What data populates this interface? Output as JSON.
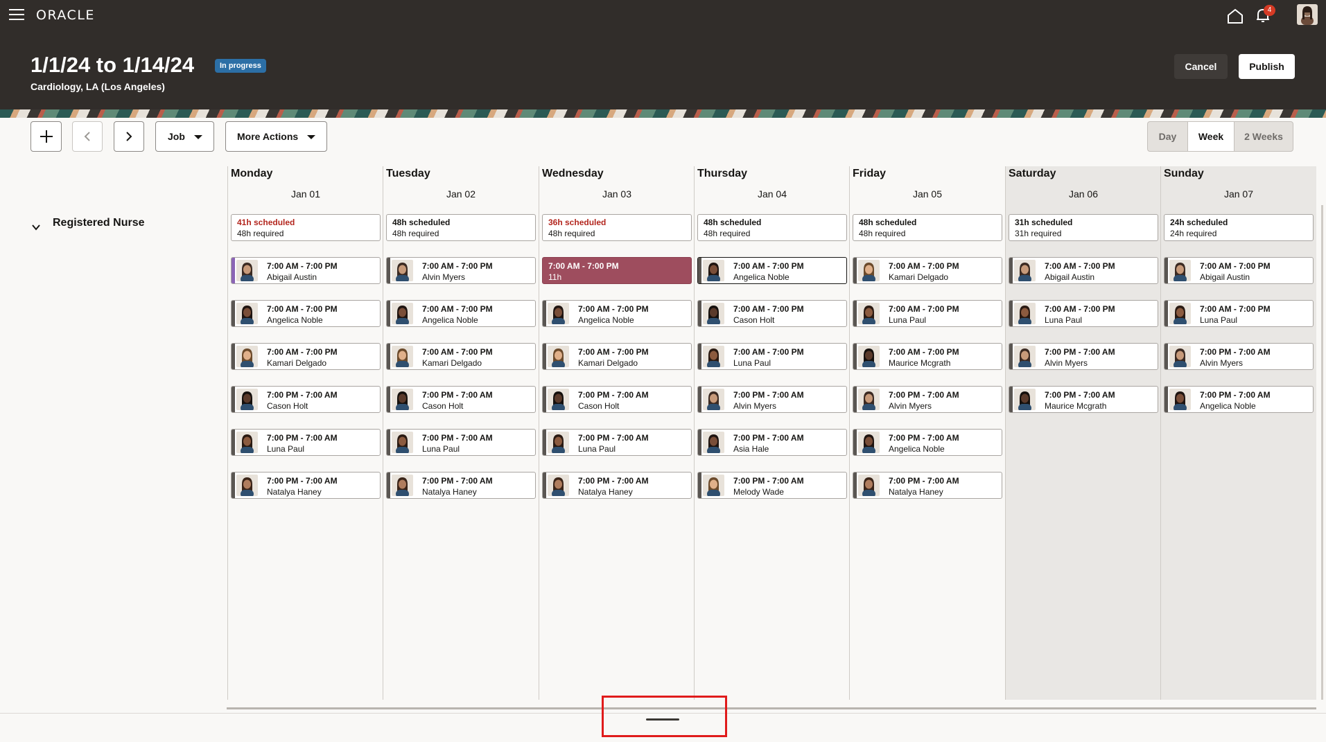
{
  "app": {
    "logo": "ORACLE",
    "notification_count": "4"
  },
  "header": {
    "title": "1/1/24 to 1/14/24",
    "status": "In progress",
    "subtitle": "Cardiology, LA (Los Angeles)",
    "cancel_label": "Cancel",
    "publish_label": "Publish"
  },
  "toolbar": {
    "job_label": "Job",
    "more_actions_label": "More Actions",
    "views": [
      {
        "label": "Day",
        "active": false
      },
      {
        "label": "Week",
        "active": true
      },
      {
        "label": "2 Weeks",
        "active": false
      }
    ]
  },
  "group": {
    "label": "Registered Nurse"
  },
  "days": [
    {
      "name": "Monday",
      "date": "Jan 01",
      "weekend": false,
      "scheduled": "41h scheduled",
      "required": "48h required",
      "under": true,
      "shifts": [
        {
          "time": "7:00 AM - 7:00 PM",
          "person": "Abigail Austin",
          "bar": "#8b64b5"
        },
        {
          "time": "7:00 AM - 7:00 PM",
          "person": "Angelica Noble"
        },
        {
          "time": "7:00 AM - 7:00 PM",
          "person": "Kamari Delgado"
        },
        {
          "time": "7:00 PM - 7:00 AM",
          "person": "Cason Holt"
        },
        {
          "time": "7:00 PM - 7:00 AM",
          "person": "Luna Paul"
        },
        {
          "time": "7:00 PM - 7:00 AM",
          "person": "Natalya Haney"
        }
      ]
    },
    {
      "name": "Tuesday",
      "date": "Jan 02",
      "weekend": false,
      "scheduled": "48h scheduled",
      "required": "48h required",
      "under": false,
      "shifts": [
        {
          "time": "7:00 AM - 7:00 PM",
          "person": "Alvin Myers"
        },
        {
          "time": "7:00 AM - 7:00 PM",
          "person": "Angelica Noble"
        },
        {
          "time": "7:00 AM - 7:00 PM",
          "person": "Kamari Delgado"
        },
        {
          "time": "7:00 PM - 7:00 AM",
          "person": "Cason Holt"
        },
        {
          "time": "7:00 PM - 7:00 AM",
          "person": "Luna Paul"
        },
        {
          "time": "7:00 PM - 7:00 AM",
          "person": "Natalya Haney"
        }
      ]
    },
    {
      "name": "Wednesday",
      "date": "Jan 03",
      "weekend": false,
      "scheduled": "36h scheduled",
      "required": "48h required",
      "under": true,
      "shifts": [
        {
          "time": "7:00 AM - 7:00 PM",
          "person": "11h",
          "open": true
        },
        {
          "time": "7:00 AM - 7:00 PM",
          "person": "Angelica Noble"
        },
        {
          "time": "7:00 AM - 7:00 PM",
          "person": "Kamari Delgado"
        },
        {
          "time": "7:00 PM - 7:00 AM",
          "person": "Cason Holt"
        },
        {
          "time": "7:00 PM - 7:00 AM",
          "person": "Luna Paul"
        },
        {
          "time": "7:00 PM - 7:00 AM",
          "person": "Natalya Haney"
        }
      ]
    },
    {
      "name": "Thursday",
      "date": "Jan 04",
      "weekend": false,
      "scheduled": "48h scheduled",
      "required": "48h required",
      "under": false,
      "shifts": [
        {
          "time": "7:00 AM - 7:00 PM",
          "person": "Angelica Noble",
          "selected": true
        },
        {
          "time": "7:00 AM - 7:00 PM",
          "person": "Cason Holt"
        },
        {
          "time": "7:00 AM - 7:00 PM",
          "person": "Luna Paul"
        },
        {
          "time": "7:00 PM - 7:00 AM",
          "person": "Alvin Myers"
        },
        {
          "time": "7:00 PM - 7:00 AM",
          "person": "Asia Hale"
        },
        {
          "time": "7:00 PM - 7:00 AM",
          "person": "Melody Wade"
        }
      ]
    },
    {
      "name": "Friday",
      "date": "Jan 05",
      "weekend": false,
      "scheduled": "48h scheduled",
      "required": "48h required",
      "under": false,
      "shifts": [
        {
          "time": "7:00 AM - 7:00 PM",
          "person": "Kamari Delgado"
        },
        {
          "time": "7:00 AM - 7:00 PM",
          "person": "Luna Paul"
        },
        {
          "time": "7:00 AM - 7:00 PM",
          "person": "Maurice Mcgrath"
        },
        {
          "time": "7:00 PM - 7:00 AM",
          "person": "Alvin Myers"
        },
        {
          "time": "7:00 PM - 7:00 AM",
          "person": "Angelica Noble"
        },
        {
          "time": "7:00 PM - 7:00 AM",
          "person": "Natalya Haney"
        }
      ]
    },
    {
      "name": "Saturday",
      "date": "Jan 06",
      "weekend": true,
      "scheduled": "31h scheduled",
      "required": "31h required",
      "under": false,
      "shifts": [
        {
          "time": "7:00 AM - 7:00 PM",
          "person": "Abigail Austin"
        },
        {
          "time": "7:00 AM - 7:00 PM",
          "person": "Luna Paul"
        },
        {
          "time": "7:00 PM - 7:00 AM",
          "person": "Alvin Myers"
        },
        {
          "time": "7:00 PM - 7:00 AM",
          "person": "Maurice Mcgrath"
        }
      ]
    },
    {
      "name": "Sunday",
      "date": "Jan 07",
      "weekend": true,
      "scheduled": "24h scheduled",
      "required": "24h required",
      "under": false,
      "shifts": [
        {
          "time": "7:00 AM - 7:00 PM",
          "person": "Abigail Austin"
        },
        {
          "time": "7:00 AM - 7:00 PM",
          "person": "Luna Paul"
        },
        {
          "time": "7:00 PM - 7:00 AM",
          "person": "Alvin Myers"
        },
        {
          "time": "7:00 PM - 7:00 AM",
          "person": "Angelica Noble"
        }
      ]
    }
  ],
  "icons": {
    "menu": "hamburger-icon",
    "home": "home-icon",
    "notifications": "bell-icon",
    "add": "plus-icon",
    "prev": "chevron-left-icon",
    "next": "chevron-right-icon",
    "group_toggle": "chevron-down-icon"
  },
  "colors": {
    "header_bg": "#312d2a",
    "status_badge": "#2c6fa6",
    "open_shift": "#9e4d5e",
    "under_scheduled": "#b3261e",
    "highlight": "#e01b1b"
  }
}
